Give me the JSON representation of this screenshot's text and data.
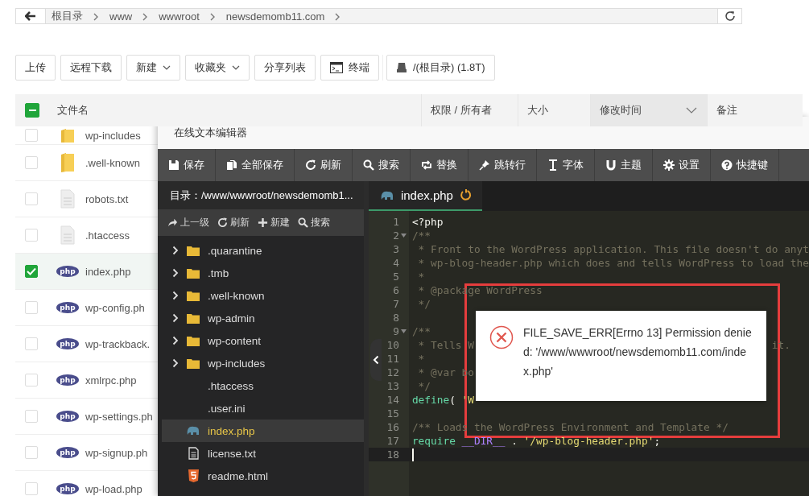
{
  "breadcrumb": {
    "items": [
      "根目录",
      "www",
      "wwwroot",
      "newsdemomb11.com"
    ]
  },
  "toolbar": [
    {
      "label": "上传",
      "kind": "plain"
    },
    {
      "label": "远程下载",
      "kind": "plain"
    },
    {
      "label": "新建",
      "kind": "dropdown"
    },
    {
      "label": "收藏夹",
      "kind": "dropdown"
    },
    {
      "label": "分享列表",
      "kind": "plain"
    },
    {
      "label": "终端",
      "kind": "terminal"
    },
    {
      "label": "/(根目录) (1.8T)",
      "kind": "disk"
    }
  ],
  "table": {
    "select_all_indeterminate": true,
    "columns": [
      {
        "label": "文件名",
        "sorted": false
      },
      {
        "label": "权限 / 所有者",
        "sorted": false
      },
      {
        "label": "大小",
        "sorted": false
      },
      {
        "label": "修改时间",
        "sorted": true
      },
      {
        "label": "备注",
        "sorted": false
      }
    ],
    "rows": [
      {
        "name": "wp-includes",
        "kind": "folder",
        "selected": false
      },
      {
        "name": ".well-known",
        "kind": "folder",
        "selected": false
      },
      {
        "name": "robots.txt",
        "kind": "text",
        "selected": false
      },
      {
        "name": ".htaccess",
        "kind": "text",
        "selected": false
      },
      {
        "name": "index.php",
        "kind": "php",
        "icon_label": "php",
        "selected": true
      },
      {
        "name": "wp-config.ph",
        "kind": "php",
        "icon_label": "php",
        "selected": false
      },
      {
        "name": "wp-trackback.",
        "kind": "php",
        "icon_label": "php",
        "selected": false
      },
      {
        "name": "xmlrpc.php",
        "kind": "php",
        "icon_label": "php",
        "selected": false
      },
      {
        "name": "wp-settings.ph",
        "kind": "php",
        "icon_label": "php",
        "selected": false
      },
      {
        "name": "wp-signup.ph",
        "kind": "php",
        "icon_label": "php",
        "selected": false
      },
      {
        "name": "wp-load.php",
        "kind": "php",
        "icon_label": "php",
        "selected": false
      }
    ]
  },
  "editor": {
    "title": "在线文本编辑器",
    "toolbar": [
      {
        "label": "保存"
      },
      {
        "label": "全部保存"
      },
      {
        "label": "刷新"
      },
      {
        "label": "搜索"
      },
      {
        "label": "替换"
      },
      {
        "label": "跳转行"
      },
      {
        "label": "字体"
      },
      {
        "label": "主题"
      },
      {
        "label": "设置"
      },
      {
        "label": "快捷键"
      }
    ],
    "sidebar": {
      "path": "目录：/www/wwwroot/newsdemomb1...",
      "actions": [
        {
          "label": "上一级"
        },
        {
          "label": "刷新"
        },
        {
          "label": "新建"
        },
        {
          "label": "搜索"
        }
      ],
      "tree": [
        {
          "name": ".quarantine",
          "kind": "folder",
          "selected": false
        },
        {
          "name": ".tmb",
          "kind": "folder",
          "selected": false
        },
        {
          "name": ".well-known",
          "kind": "folder",
          "selected": false
        },
        {
          "name": "wp-admin",
          "kind": "folder",
          "selected": false
        },
        {
          "name": "wp-content",
          "kind": "folder",
          "selected": false
        },
        {
          "name": "wp-includes",
          "kind": "folder",
          "selected": false
        },
        {
          "name": ".htaccess",
          "kind": "plain",
          "selected": false
        },
        {
          "name": ".user.ini",
          "kind": "plain",
          "selected": false
        },
        {
          "name": "index.php",
          "kind": "php",
          "selected": true
        },
        {
          "name": "license.txt",
          "kind": "text",
          "selected": false
        },
        {
          "name": "readme.html",
          "kind": "html",
          "selected": false
        }
      ]
    },
    "tab": {
      "label": "index.php",
      "selected": true
    },
    "lines": [
      {
        "number": "1",
        "fold": false,
        "current": false,
        "tokens": [
          {
            "kind": "plain",
            "text": "<?php"
          }
        ]
      },
      {
        "number": "2",
        "fold": true,
        "current": false,
        "tokens": [
          {
            "kind": "comment",
            "text": "/**"
          }
        ]
      },
      {
        "number": "3",
        "fold": false,
        "current": false,
        "tokens": [
          {
            "kind": "comment",
            "text": " * Front to the WordPress application. This file doesn't do anyt"
          }
        ]
      },
      {
        "number": "4",
        "fold": false,
        "current": false,
        "tokens": [
          {
            "kind": "comment",
            "text": " * wp-blog-header.php which does and tells WordPress to load the"
          }
        ]
      },
      {
        "number": "5",
        "fold": false,
        "current": false,
        "tokens": [
          {
            "kind": "comment",
            "text": " *"
          }
        ]
      },
      {
        "number": "6",
        "fold": false,
        "current": false,
        "tokens": [
          {
            "kind": "comment",
            "text": " * @package WordPress"
          }
        ]
      },
      {
        "number": "7",
        "fold": false,
        "current": false,
        "tokens": [
          {
            "kind": "comment",
            "text": " */"
          }
        ]
      },
      {
        "number": "8",
        "fold": false,
        "current": false
      },
      {
        "number": "9",
        "fold": true,
        "current": false,
        "tokens": [
          {
            "kind": "comment",
            "text": "/**"
          }
        ]
      },
      {
        "number": "10",
        "fold": false,
        "current": false,
        "tokens": [
          {
            "kind": "comment",
            "text": " * Tells W"
          }
        ],
        "tail": "it."
      },
      {
        "number": "11",
        "fold": false,
        "current": false,
        "tokens": [
          {
            "kind": "comment",
            "text": " *"
          }
        ]
      },
      {
        "number": "12",
        "fold": false,
        "current": false,
        "tokens": [
          {
            "kind": "comment",
            "text": " * @var bo"
          }
        ]
      },
      {
        "number": "13",
        "fold": false,
        "current": false,
        "tokens": [
          {
            "kind": "comment",
            "text": " */"
          }
        ]
      },
      {
        "number": "14",
        "fold": false,
        "current": false,
        "tokens": [
          {
            "kind": "keyword",
            "text": "define"
          },
          {
            "kind": "plain",
            "text": "( "
          },
          {
            "kind": "string",
            "text": "'W"
          }
        ]
      },
      {
        "number": "15",
        "fold": false,
        "current": false
      },
      {
        "number": "16",
        "fold": false,
        "current": false,
        "tokens": [
          {
            "kind": "comment",
            "text": "/** Loads the WordPress Environment and Template */"
          }
        ]
      },
      {
        "number": "17",
        "fold": false,
        "current": false,
        "tokens": [
          {
            "kind": "keyword",
            "text": "require"
          },
          {
            "kind": "constant",
            "text": " __DIR__"
          },
          {
            "kind": "plain",
            "text": " . "
          },
          {
            "kind": "string",
            "text": "'/wp-blog-header.php'"
          },
          {
            "kind": "plain",
            "text": ";"
          }
        ]
      },
      {
        "number": "18",
        "fold": false,
        "current": true
      }
    ]
  },
  "dialog": {
    "message": "FILE_SAVE_ERR[Errno 13] Permission denied: '/www/wwwroot/newsdemomb11.com/index.php'"
  }
}
